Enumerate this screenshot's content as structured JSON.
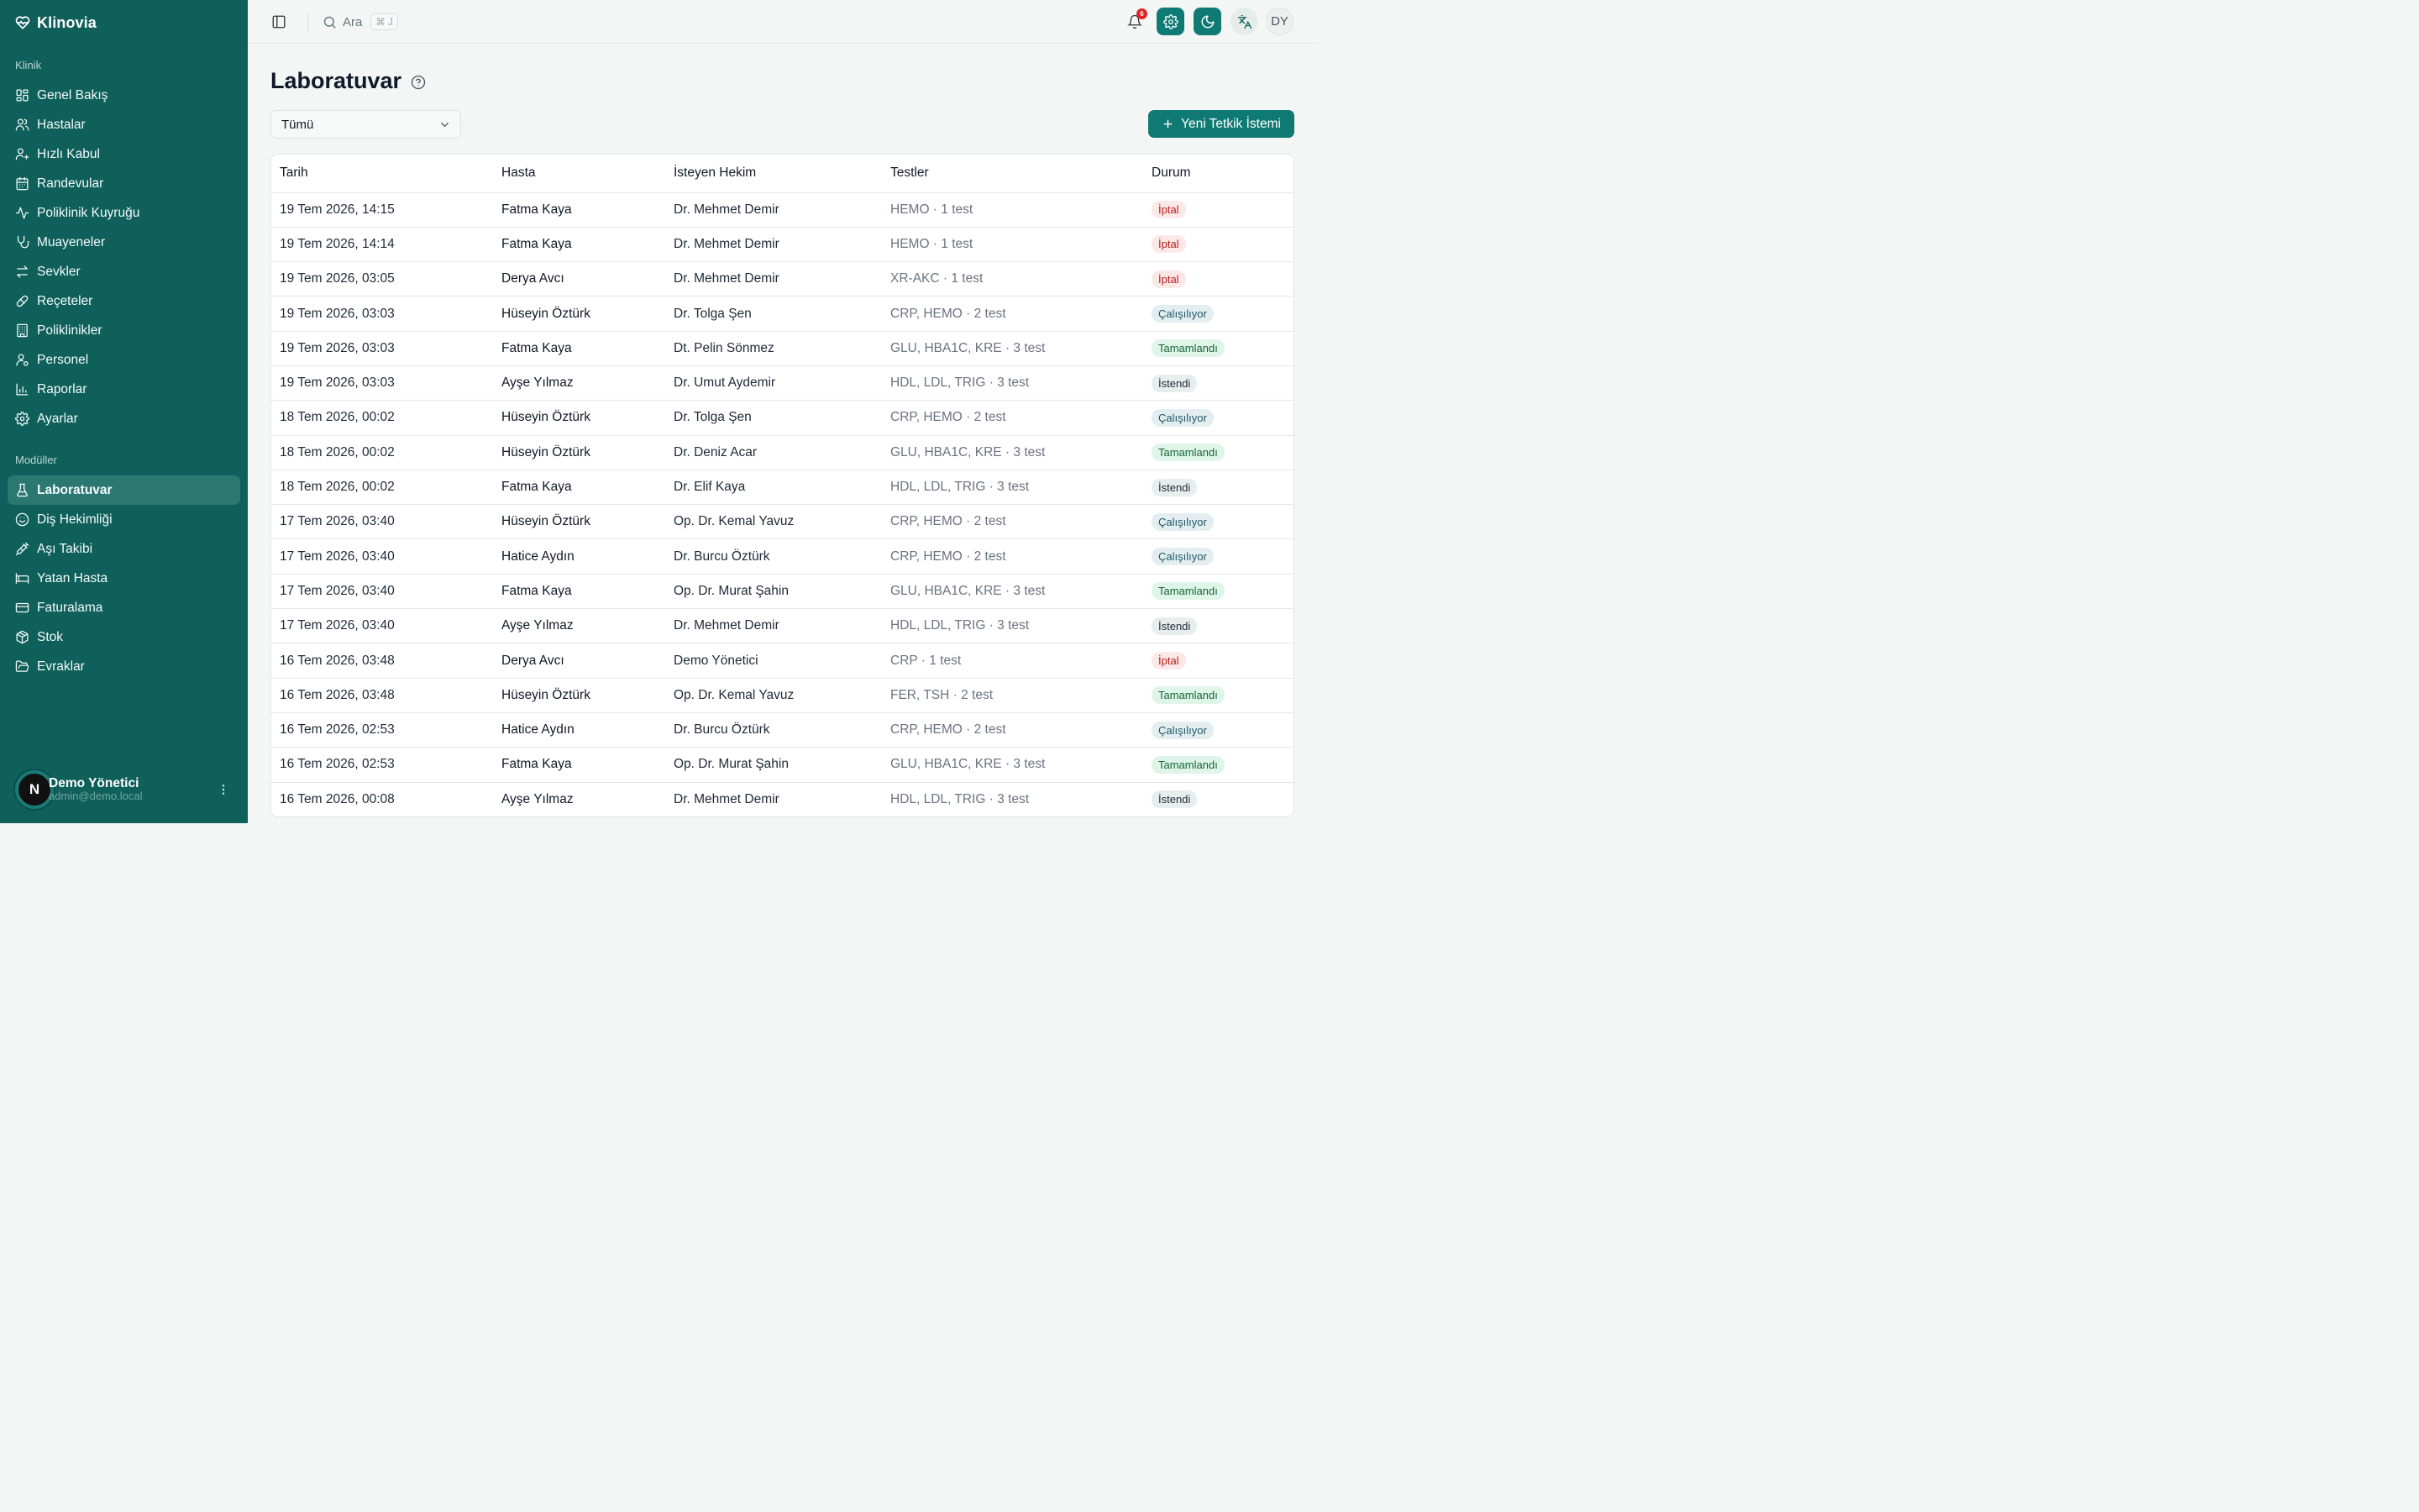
{
  "app": {
    "name": "Klinovia"
  },
  "sidebar": {
    "sections": [
      {
        "title": "Klinik",
        "items": [
          {
            "label": "Genel Bakış",
            "icon": "dashboard-icon"
          },
          {
            "label": "Hastalar",
            "icon": "users-icon"
          },
          {
            "label": "Hızlı Kabul",
            "icon": "user-plus-icon"
          },
          {
            "label": "Randevular",
            "icon": "calendar-icon"
          },
          {
            "label": "Poliklinik Kuyruğu",
            "icon": "activity-icon"
          },
          {
            "label": "Muayeneler",
            "icon": "stethoscope-icon"
          },
          {
            "label": "Sevkler",
            "icon": "transfer-icon"
          },
          {
            "label": "Reçeteler",
            "icon": "pill-icon"
          },
          {
            "label": "Poliklinikler",
            "icon": "building-icon"
          },
          {
            "label": "Personel",
            "icon": "staff-icon"
          },
          {
            "label": "Raporlar",
            "icon": "bar-chart-icon"
          },
          {
            "label": "Ayarlar",
            "icon": "gear-icon"
          }
        ]
      },
      {
        "title": "Modüller",
        "items": [
          {
            "label": "Laboratuvar",
            "icon": "flask-icon",
            "active": true
          },
          {
            "label": "Diş Hekimliği",
            "icon": "smile-icon"
          },
          {
            "label": "Aşı Takibi",
            "icon": "syringe-icon"
          },
          {
            "label": "Yatan Hasta",
            "icon": "bed-icon"
          },
          {
            "label": "Faturalama",
            "icon": "credit-card-icon"
          },
          {
            "label": "Stok",
            "icon": "package-icon"
          },
          {
            "label": "Evraklar",
            "icon": "folder-icon"
          }
        ]
      }
    ],
    "user": {
      "avatar_letter": "N",
      "name": "Demo Yönetici",
      "email": "admin@demo.local"
    }
  },
  "topbar": {
    "search_label": "Ara",
    "search_shortcut": "⌘ J",
    "notification_count": "6",
    "user_initials": "DY"
  },
  "page": {
    "title": "Laboratuvar",
    "filter_value": "Tümü",
    "new_button_label": "Yeni Tetkik İstemi"
  },
  "table": {
    "columns": [
      "Tarih",
      "Hasta",
      "İsteyen Hekim",
      "Testler",
      "Durum"
    ],
    "rows": [
      {
        "date": "19 Tem 2026, 14:15",
        "patient": "Fatma Kaya",
        "doctor": "Dr. Mehmet Demir",
        "tests": "HEMO · 1 test",
        "status": "İptal",
        "status_type": "iptal"
      },
      {
        "date": "19 Tem 2026, 14:14",
        "patient": "Fatma Kaya",
        "doctor": "Dr. Mehmet Demir",
        "tests": "HEMO · 1 test",
        "status": "İptal",
        "status_type": "iptal"
      },
      {
        "date": "19 Tem 2026, 03:05",
        "patient": "Derya Avcı",
        "doctor": "Dr. Mehmet Demir",
        "tests": "XR-AKC · 1 test",
        "status": "İptal",
        "status_type": "iptal"
      },
      {
        "date": "19 Tem 2026, 03:03",
        "patient": "Hüseyin Öztürk",
        "doctor": "Dr. Tolga Şen",
        "tests": "CRP, HEMO · 2 test",
        "status": "Çalışılıyor",
        "status_type": "calisiyor"
      },
      {
        "date": "19 Tem 2026, 03:03",
        "patient": "Fatma Kaya",
        "doctor": "Dt. Pelin Sönmez",
        "tests": "GLU, HBA1C, KRE · 3 test",
        "status": "Tamamlandı",
        "status_type": "tamam"
      },
      {
        "date": "19 Tem 2026, 03:03",
        "patient": "Ayşe Yılmaz",
        "doctor": "Dr. Umut Aydemir",
        "tests": "HDL, LDL, TRIG · 3 test",
        "status": "İstendi",
        "status_type": "istendi"
      },
      {
        "date": "18 Tem 2026, 00:02",
        "patient": "Hüseyin Öztürk",
        "doctor": "Dr. Tolga Şen",
        "tests": "CRP, HEMO · 2 test",
        "status": "Çalışılıyor",
        "status_type": "calisiyor"
      },
      {
        "date": "18 Tem 2026, 00:02",
        "patient": "Hüseyin Öztürk",
        "doctor": "Dr. Deniz Acar",
        "tests": "GLU, HBA1C, KRE · 3 test",
        "status": "Tamamlandı",
        "status_type": "tamam"
      },
      {
        "date": "18 Tem 2026, 00:02",
        "patient": "Fatma Kaya",
        "doctor": "Dr. Elif Kaya",
        "tests": "HDL, LDL, TRIG · 3 test",
        "status": "İstendi",
        "status_type": "istendi"
      },
      {
        "date": "17 Tem 2026, 03:40",
        "patient": "Hüseyin Öztürk",
        "doctor": "Op. Dr. Kemal Yavuz",
        "tests": "CRP, HEMO · 2 test",
        "status": "Çalışılıyor",
        "status_type": "calisiyor"
      },
      {
        "date": "17 Tem 2026, 03:40",
        "patient": "Hatice Aydın",
        "doctor": "Dr. Burcu Öztürk",
        "tests": "CRP, HEMO · 2 test",
        "status": "Çalışılıyor",
        "status_type": "calisiyor"
      },
      {
        "date": "17 Tem 2026, 03:40",
        "patient": "Fatma Kaya",
        "doctor": "Op. Dr. Murat Şahin",
        "tests": "GLU, HBA1C, KRE · 3 test",
        "status": "Tamamlandı",
        "status_type": "tamam"
      },
      {
        "date": "17 Tem 2026, 03:40",
        "patient": "Ayşe Yılmaz",
        "doctor": "Dr. Mehmet Demir",
        "tests": "HDL, LDL, TRIG · 3 test",
        "status": "İstendi",
        "status_type": "istendi"
      },
      {
        "date": "16 Tem 2026, 03:48",
        "patient": "Derya Avcı",
        "doctor": "Demo Yönetici",
        "tests": "CRP · 1 test",
        "status": "İptal",
        "status_type": "iptal"
      },
      {
        "date": "16 Tem 2026, 03:48",
        "patient": "Hüseyin Öztürk",
        "doctor": "Op. Dr. Kemal Yavuz",
        "tests": "FER, TSH · 2 test",
        "status": "Tamamlandı",
        "status_type": "tamam"
      },
      {
        "date": "16 Tem 2026, 02:53",
        "patient": "Hatice Aydın",
        "doctor": "Dr. Burcu Öztürk",
        "tests": "CRP, HEMO · 2 test",
        "status": "Çalışılıyor",
        "status_type": "calisiyor"
      },
      {
        "date": "16 Tem 2026, 02:53",
        "patient": "Fatma Kaya",
        "doctor": "Op. Dr. Murat Şahin",
        "tests": "GLU, HBA1C, KRE · 3 test",
        "status": "Tamamlandı",
        "status_type": "tamam"
      },
      {
        "date": "16 Tem 2026, 00:08",
        "patient": "Ayşe Yılmaz",
        "doctor": "Dr. Mehmet Demir",
        "tests": "HDL, LDL, TRIG · 3 test",
        "status": "İstendi",
        "status_type": "istendi"
      }
    ]
  },
  "colors": {
    "sidebar_bg": "#0f5f5b",
    "accent": "#0f7a73",
    "cancel": "#b91c1c",
    "done": "#166534"
  }
}
